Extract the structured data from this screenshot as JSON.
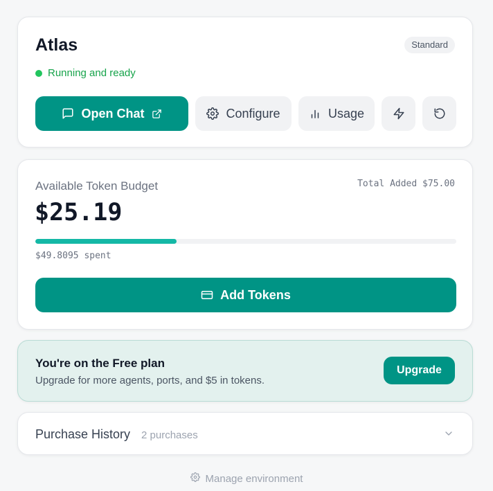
{
  "agent": {
    "name": "Atlas",
    "tier": "Standard",
    "status": "Running and ready",
    "status_color": "#22c55e",
    "actions": {
      "open_chat": "Open Chat",
      "configure": "Configure",
      "usage": "Usage"
    }
  },
  "budget": {
    "label": "Available Token Budget",
    "total_added": "Total Added $75.00",
    "balance": "$25.19",
    "spent_fraction": 0.336,
    "spent_text": "$49.8095 spent",
    "add_tokens": "Add Tokens"
  },
  "plan": {
    "title": "You're on the Free plan",
    "subtitle": "Upgrade for more agents, ports, and $5 in tokens.",
    "upgrade": "Upgrade"
  },
  "history": {
    "title": "Purchase History",
    "count": "2 purchases"
  },
  "manage_env": "Manage environment",
  "colors": {
    "accent": "#009485",
    "progress": "#14b8a6",
    "banner_bg": "#e3f1ee"
  },
  "icons": [
    "chat-icon",
    "external-link-icon",
    "gear-icon",
    "bar-chart-icon",
    "lightning-icon",
    "restart-icon",
    "card-icon",
    "chevron-down-icon"
  ]
}
